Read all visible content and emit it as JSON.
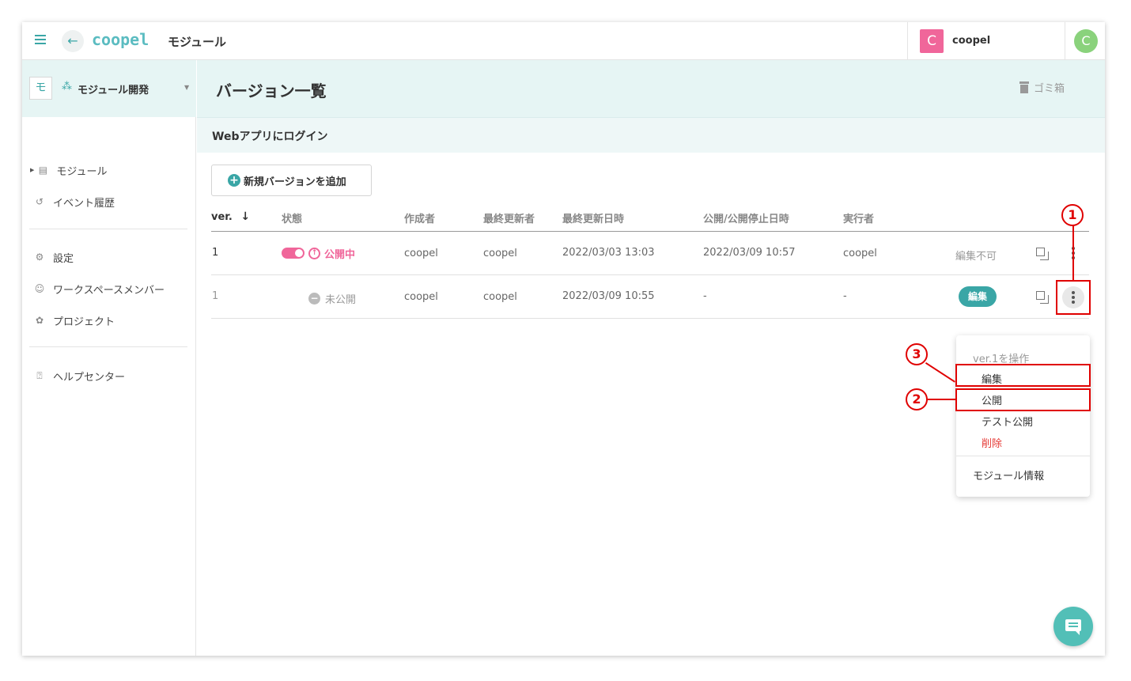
{
  "app": {
    "logo": "coopel",
    "title": "モジュール"
  },
  "workspace": {
    "avatar_letter": "C",
    "name": "coopel",
    "color": "#f0669a"
  },
  "user": {
    "avatar_letter": "C",
    "color": "#8ad27c"
  },
  "sidebar": {
    "project_badge": "モ",
    "project_name": "モジュール開発",
    "items": [
      {
        "label": "モジュール",
        "icon": "module-icon"
      },
      {
        "label": "イベント履歴",
        "icon": "history-icon"
      },
      {
        "label": "設定",
        "icon": "gear-icon"
      },
      {
        "label": "ワークスペースメンバー",
        "icon": "members-icon"
      },
      {
        "label": "プロジェクト",
        "icon": "project-icon"
      },
      {
        "label": "ヘルプセンター",
        "icon": "help-icon"
      }
    ]
  },
  "page": {
    "title": "バージョン一覧",
    "trash_label": "ゴミ箱",
    "module_name": "Webアプリにログイン",
    "add_button": "新規バージョンを追加"
  },
  "table": {
    "headers": {
      "ver": "ver.",
      "status": "状態",
      "author": "作成者",
      "updater": "最終更新者",
      "updated_at": "最終更新日時",
      "published_at": "公開/公開停止日時",
      "executor": "実行者"
    },
    "rows": [
      {
        "ver": "1",
        "status": "公開中",
        "author": "coopel",
        "updater": "coopel",
        "updated_at": "2022/03/03 13:03",
        "published_at": "2022/03/09 10:57",
        "executor": "coopel",
        "action": "編集不可"
      },
      {
        "ver": "1",
        "status": "未公開",
        "author": "coopel",
        "updater": "coopel",
        "updated_at": "2022/03/09 10:55",
        "published_at": "-",
        "executor": "-",
        "action": "編集"
      }
    ]
  },
  "menu": {
    "caption": "ver.1を操作",
    "items": [
      "編集",
      "公開",
      "テスト公開",
      "削除"
    ],
    "info": "モジュール情報"
  },
  "annotations": [
    "1",
    "2",
    "3"
  ],
  "colors": {
    "accent": "#3aa6a6",
    "published": "#f0669a",
    "danger": "#e53935",
    "annotation": "#e00000"
  }
}
